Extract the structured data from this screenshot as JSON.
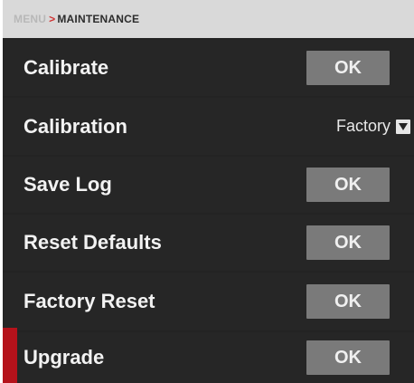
{
  "breadcrumb": {
    "menu": "MENU",
    "separator": ">",
    "current": "MAINTENANCE"
  },
  "rows": [
    {
      "label": "Calibrate",
      "button": "OK"
    },
    {
      "label": "Calibration",
      "value": "Factory"
    },
    {
      "label": "Save Log",
      "button": "OK"
    },
    {
      "label": "Reset Defaults",
      "button": "OK"
    },
    {
      "label": "Factory Reset",
      "button": "OK"
    },
    {
      "label": "Upgrade",
      "button": "OK"
    }
  ],
  "colors": {
    "panel_bg": "#232323",
    "button_bg": "#7a7a7a",
    "accent_red": "#b5121b",
    "breadcrumb_bg": "#d9d9d9"
  },
  "icons": {
    "dropdown": "chevron-down-icon"
  }
}
